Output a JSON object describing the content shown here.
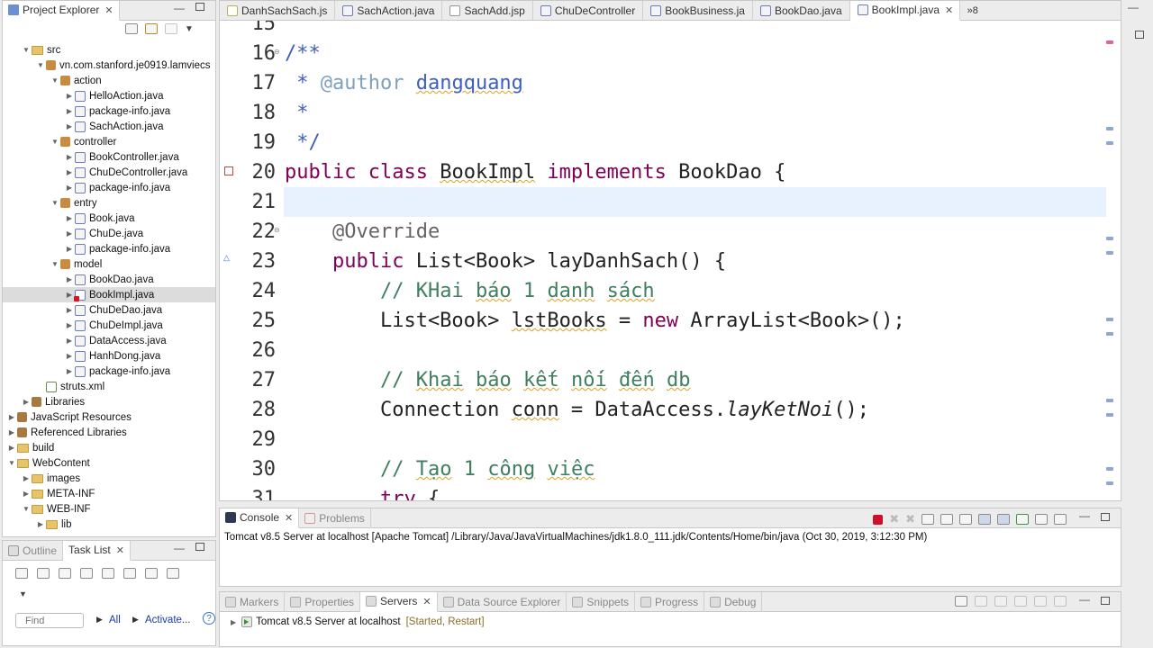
{
  "project_explorer": {
    "title": "Project Explorer",
    "tree": [
      {
        "label": "src",
        "depth": 1,
        "icon": "folder-src-icon",
        "expanded": true
      },
      {
        "label": "vn.com.stanford.je0919.lamviecs",
        "depth": 2,
        "icon": "package-icon",
        "expanded": true
      },
      {
        "label": "action",
        "depth": 3,
        "icon": "package-icon",
        "expanded": true
      },
      {
        "label": "HelloAction.java",
        "depth": 4,
        "icon": "java-file-icon"
      },
      {
        "label": "package-info.java",
        "depth": 4,
        "icon": "java-file-icon"
      },
      {
        "label": "SachAction.java",
        "depth": 4,
        "icon": "java-file-icon"
      },
      {
        "label": "controller",
        "depth": 3,
        "icon": "package-icon",
        "expanded": true
      },
      {
        "label": "BookController.java",
        "depth": 4,
        "icon": "java-file-icon"
      },
      {
        "label": "ChuDeController.java",
        "depth": 4,
        "icon": "java-file-icon"
      },
      {
        "label": "package-info.java",
        "depth": 4,
        "icon": "java-file-icon"
      },
      {
        "label": "entry",
        "depth": 3,
        "icon": "package-icon",
        "expanded": true
      },
      {
        "label": "Book.java",
        "depth": 4,
        "icon": "java-file-icon"
      },
      {
        "label": "ChuDe.java",
        "depth": 4,
        "icon": "java-file-icon"
      },
      {
        "label": "package-info.java",
        "depth": 4,
        "icon": "java-file-icon"
      },
      {
        "label": "model",
        "depth": 3,
        "icon": "package-icon",
        "expanded": true
      },
      {
        "label": "BookDao.java",
        "depth": 4,
        "icon": "java-file-icon"
      },
      {
        "label": "BookImpl.java",
        "depth": 4,
        "icon": "java-file-error-icon",
        "selected": true
      },
      {
        "label": "ChuDeDao.java",
        "depth": 4,
        "icon": "java-file-icon"
      },
      {
        "label": "ChuDeImpl.java",
        "depth": 4,
        "icon": "java-file-icon"
      },
      {
        "label": "DataAccess.java",
        "depth": 4,
        "icon": "java-file-icon"
      },
      {
        "label": "HanhDong.java",
        "depth": 4,
        "icon": "java-file-icon"
      },
      {
        "label": "package-info.java",
        "depth": 4,
        "icon": "java-file-icon"
      },
      {
        "label": "struts.xml",
        "depth": 2,
        "icon": "xml-file-icon",
        "leaf": true
      },
      {
        "label": "Libraries",
        "depth": 1,
        "icon": "library-icon"
      },
      {
        "label": "JavaScript Resources",
        "depth": 0,
        "icon": "library-icon"
      },
      {
        "label": "Referenced Libraries",
        "depth": 0,
        "icon": "library-icon"
      },
      {
        "label": "build",
        "depth": 0,
        "icon": "folder-icon"
      },
      {
        "label": "WebContent",
        "depth": 0,
        "icon": "folder-icon",
        "expanded": true
      },
      {
        "label": "images",
        "depth": 1,
        "icon": "folder-icon"
      },
      {
        "label": "META-INF",
        "depth": 1,
        "icon": "folder-icon"
      },
      {
        "label": "WEB-INF",
        "depth": 1,
        "icon": "folder-icon",
        "expanded": true
      },
      {
        "label": "lib",
        "depth": 2,
        "icon": "folder-icon"
      }
    ]
  },
  "outline_panel": {
    "tabs": [
      "Outline",
      "Task List"
    ],
    "find_placeholder": "Find",
    "all_label": "All",
    "activate_label": "Activate..."
  },
  "editor": {
    "tabs": [
      {
        "label": "DanhSachSach.js",
        "icon": "js-file-icon"
      },
      {
        "label": "SachAction.java",
        "icon": "java-file-icon"
      },
      {
        "label": "SachAdd.jsp",
        "icon": "jsp-file-icon"
      },
      {
        "label": "ChuDeController",
        "icon": "java-file-icon"
      },
      {
        "label": "BookBusiness.ja",
        "icon": "java-file-icon"
      },
      {
        "label": "BookDao.java",
        "icon": "java-file-icon"
      },
      {
        "label": "BookImpl.java",
        "icon": "java-file-icon",
        "active": true
      }
    ],
    "overflow_label": "»8",
    "lines": [
      {
        "num": "15",
        "html": ""
      },
      {
        "num": "16",
        "html": "<span class=\"doc\">/**</span>"
      },
      {
        "num": "17",
        "html": "<span class=\"doc\"> * </span><span class=\"tag\">@author</span><span class=\"doc\"> <span class=\"sq\">dangquang</span></span>"
      },
      {
        "num": "18",
        "html": "<span class=\"doc\"> *</span>"
      },
      {
        "num": "19",
        "html": "<span class=\"doc\"> */</span>"
      },
      {
        "num": "20",
        "html": "<span class=\"kw\">public class</span> <span class=\"sq\">BookImpl</span> <span class=\"kw\">implements</span> BookDao {"
      },
      {
        "num": "21",
        "html": "",
        "highlight": true
      },
      {
        "num": "22",
        "html": "    <span class=\"ann\">@Override</span>"
      },
      {
        "num": "23",
        "html": "    <span class=\"kw\">public</span> List&lt;Book&gt; layDanhSach() {"
      },
      {
        "num": "24",
        "html": "        <span class=\"cm\">// KHai <span class=\"sq\">báo</span> 1 <span class=\"sq\">danh</span> <span class=\"sq\">sách</span></span>"
      },
      {
        "num": "25",
        "html": "        List&lt;Book&gt; <span class=\"sq\">lstBooks</span> = <span class=\"kw\">new</span> ArrayList&lt;Book&gt;();"
      },
      {
        "num": "26",
        "html": ""
      },
      {
        "num": "27",
        "html": "        <span class=\"cm\">// <span class=\"sq\">Khai</span> <span class=\"sq\">báo</span> <span class=\"sq\">kết</span> <span class=\"sq\">nối</span> <span class=\"sq\">đến</span> <span class=\"sq\">db</span></span>"
      },
      {
        "num": "28",
        "html": "        Connection <span class=\"sq\">conn</span> = DataAccess.<span class=\"it\">layKetNoi</span>();"
      },
      {
        "num": "29",
        "html": ""
      },
      {
        "num": "30",
        "html": "        <span class=\"cm\">// <span class=\"sq\">Tạo</span> 1 <span class=\"sq\">công</span> <span class=\"sq\">việc</span></span>"
      },
      {
        "num": "31",
        "html": "        <span class=\"kw\">try</span> {"
      }
    ]
  },
  "console": {
    "tabs": [
      "Console",
      "Problems"
    ],
    "status": "Tomcat v8.5 Server at localhost [Apache Tomcat] /Library/Java/JavaVirtualMachines/jdk1.8.0_111.jdk/Contents/Home/bin/java (Oct 30, 2019, 3:12:30 PM)"
  },
  "servers": {
    "tabs": [
      "Markers",
      "Properties",
      "Servers",
      "Data Source Explorer",
      "Snippets",
      "Progress",
      "Debug"
    ],
    "server_name": "Tomcat v8.5 Server at localhost",
    "server_state": "[Started, Restart]"
  }
}
